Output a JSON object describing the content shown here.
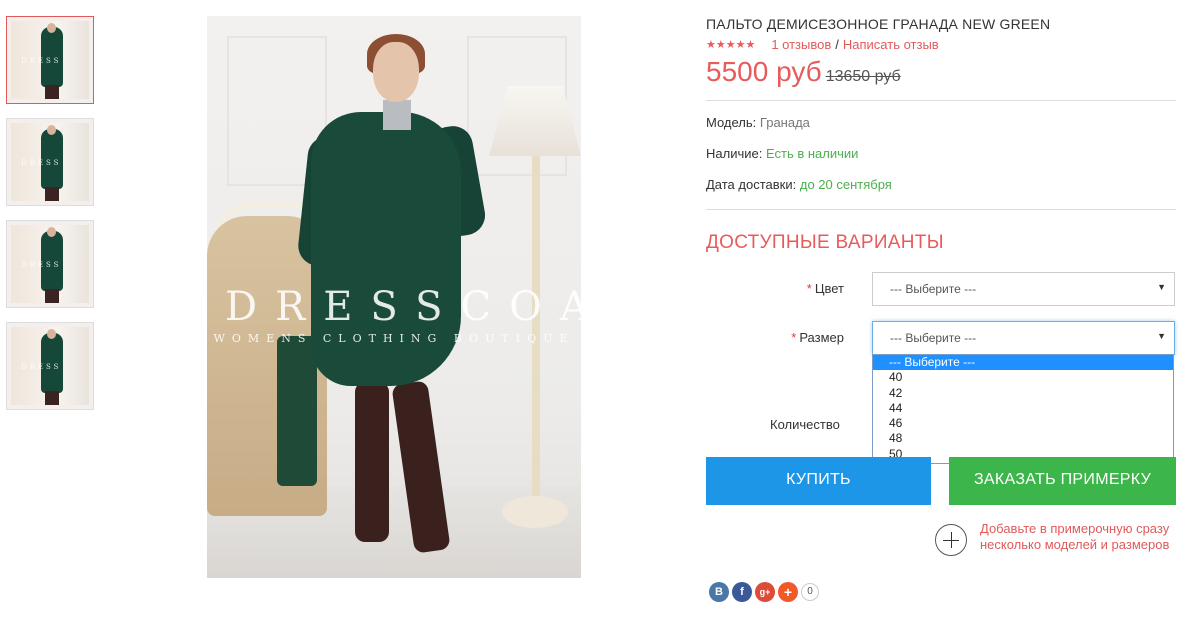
{
  "thumbnails": [
    {
      "alt": "thumb-1",
      "active": true
    },
    {
      "alt": "thumb-2",
      "active": false
    },
    {
      "alt": "thumb-3",
      "active": false
    },
    {
      "alt": "thumb-4",
      "active": false
    }
  ],
  "main_image": {
    "watermark_title": "DRESSCOAT",
    "watermark_subtitle": "WOMENS CLOTHING BOUTIQUE"
  },
  "product": {
    "title": "ПАЛЬТО ДЕМИСЕЗОННОЕ ГРАНАДА NEW GREEN",
    "stars": "★★★★★",
    "reviews_link": "1 отзывов",
    "separator": "/",
    "write_review_link": "Написать отзыв",
    "price": "5500 руб",
    "old_price": "13650 руб"
  },
  "meta": {
    "model_label": "Модель:",
    "model_value": "Гранада",
    "availability_label": "Наличие:",
    "availability_value": "Есть в наличии",
    "delivery_label": "Дата доставки:",
    "delivery_value": "до 20 сентября"
  },
  "options": {
    "title": "ДОСТУПНЫЕ ВАРИАНТЫ",
    "required_mark": "*",
    "color_label": "Цвет",
    "color_value": "--- Выберите ---",
    "size_label": "Размер",
    "size_value": "--- Выберите ---",
    "size_options": [
      "--- Выберите ---",
      "40",
      "42",
      "44",
      "46",
      "48",
      "50"
    ],
    "quantity_label": "Количество"
  },
  "buttons": {
    "buy": "КУПИТЬ",
    "fitting": "ЗАКАЗАТЬ ПРИМЕРКУ"
  },
  "fitting_note": "Добавьте в примерочную сразу несколько моделей и размеров",
  "social": {
    "vk": "В",
    "fb": "f",
    "gplus": "g+",
    "more": "+",
    "count": "0"
  },
  "colors": {
    "accent": "#e85b5b",
    "buy_button": "#1e96e8",
    "fitting_button": "#3cb54a",
    "in_stock": "#4caf50",
    "coat": "#1a4a3a"
  }
}
